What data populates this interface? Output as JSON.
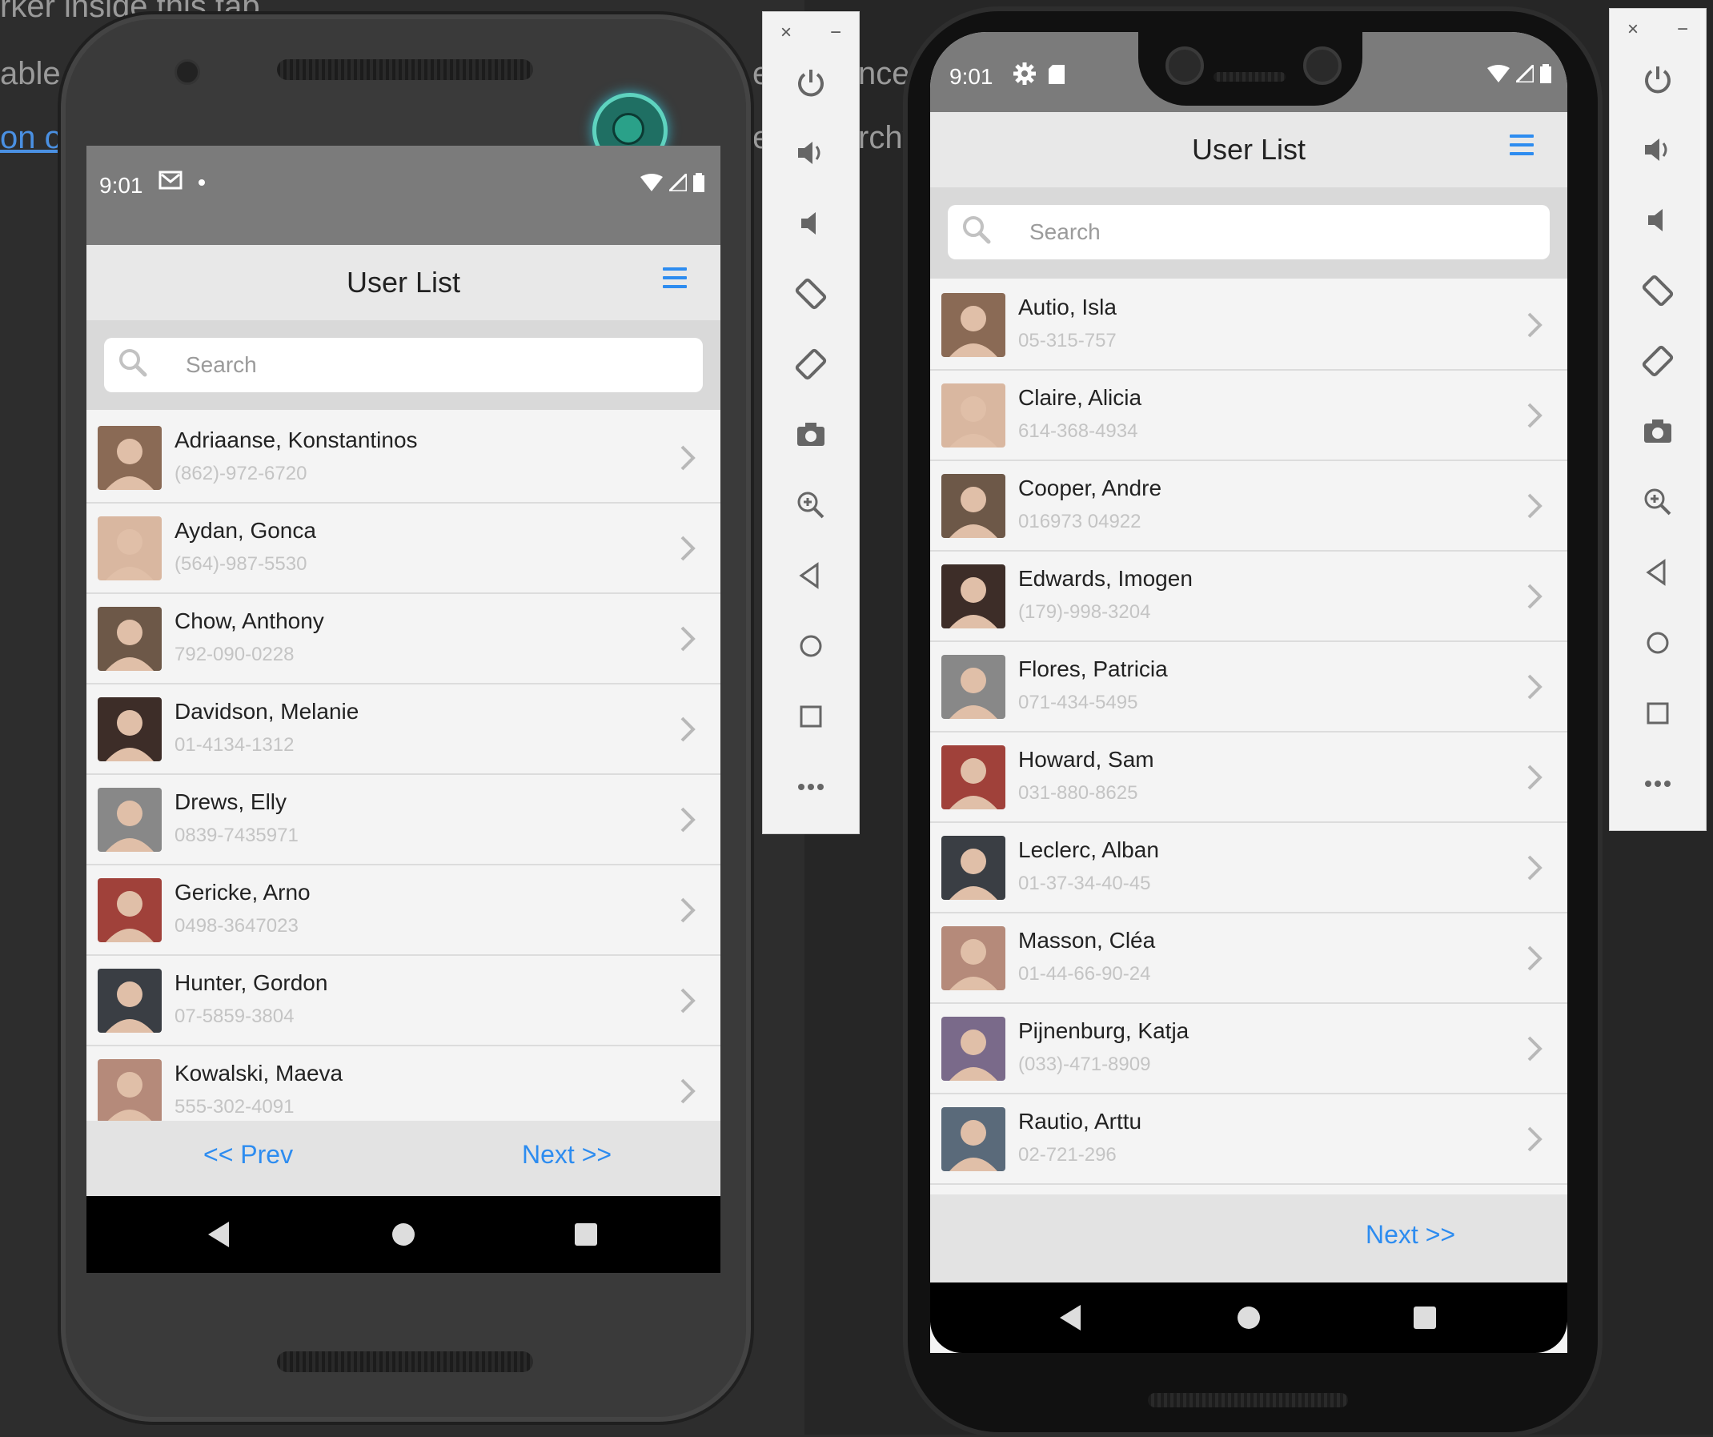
{
  "background": {
    "text_line1": "rker inside this tab",
    "text_line2a": "able",
    "text_line2b": "e",
    "text_line2c": "nce.",
    "text_line3a": "on o",
    "text_line3b": "e",
    "text_line3c": "rchy"
  },
  "colors": {
    "accent": "#2d8cf0",
    "status_bar": "#7b7b7b",
    "header": "#e8e8e8"
  },
  "phone_left": {
    "status": {
      "time": "9:01",
      "icons_left": [
        "mail-icon",
        "dot-icon"
      ],
      "icons_right": [
        "wifi-icon",
        "signal-icon",
        "battery-icon"
      ]
    },
    "header": {
      "title": "User List",
      "menu_icon": "hamburger-icon"
    },
    "search": {
      "placeholder": "Search"
    },
    "users": [
      {
        "name": "Adriaanse, Konstantinos",
        "phone": "(862)-972-6720"
      },
      {
        "name": "Aydan, Gonca",
        "phone": "(564)-987-5530"
      },
      {
        "name": "Chow, Anthony",
        "phone": "792-090-0228"
      },
      {
        "name": "Davidson, Melanie",
        "phone": "01-4134-1312"
      },
      {
        "name": "Drews, Elly",
        "phone": "0839-7435971"
      },
      {
        "name": "Gericke, Arno",
        "phone": "0498-3647023"
      },
      {
        "name": "Hunter, Gordon",
        "phone": "07-5859-3804"
      },
      {
        "name": "Kowalski, Maeva",
        "phone": "555-302-4091"
      }
    ],
    "footer": {
      "prev": "<< Prev",
      "next": "Next >>"
    }
  },
  "phone_right": {
    "status": {
      "time": "9:01",
      "icons_left": [
        "gear-icon",
        "sd-card-icon"
      ],
      "icons_right": [
        "wifi-icon",
        "signal-icon",
        "battery-icon"
      ]
    },
    "header": {
      "title": "User List",
      "menu_icon": "hamburger-icon"
    },
    "search": {
      "placeholder": "Search"
    },
    "users": [
      {
        "name": "Autio, Isla",
        "phone": "05-315-757"
      },
      {
        "name": "Claire, Alicia",
        "phone": "614-368-4934"
      },
      {
        "name": "Cooper, Andre",
        "phone": "016973 04922"
      },
      {
        "name": "Edwards, Imogen",
        "phone": "(179)-998-3204"
      },
      {
        "name": "Flores, Patricia",
        "phone": "071-434-5495"
      },
      {
        "name": "Howard, Sam",
        "phone": "031-880-8625"
      },
      {
        "name": "Leclerc, Alban",
        "phone": "01-37-34-40-45"
      },
      {
        "name": "Masson, Cléa",
        "phone": "01-44-66-90-24"
      },
      {
        "name": "Pijnenburg, Katja",
        "phone": "(033)-471-8909"
      },
      {
        "name": "Rautio, Arttu",
        "phone": "02-721-296"
      }
    ],
    "footer": {
      "next": "Next >>"
    }
  },
  "toolbar": {
    "close": "×",
    "minimize": "−",
    "buttons": [
      "power-icon",
      "volume-up-icon",
      "volume-down-icon",
      "rotate-left-icon",
      "rotate-right-icon",
      "camera-icon",
      "zoom-icon",
      "back-icon",
      "home-icon",
      "overview-icon",
      "more-icon"
    ]
  }
}
